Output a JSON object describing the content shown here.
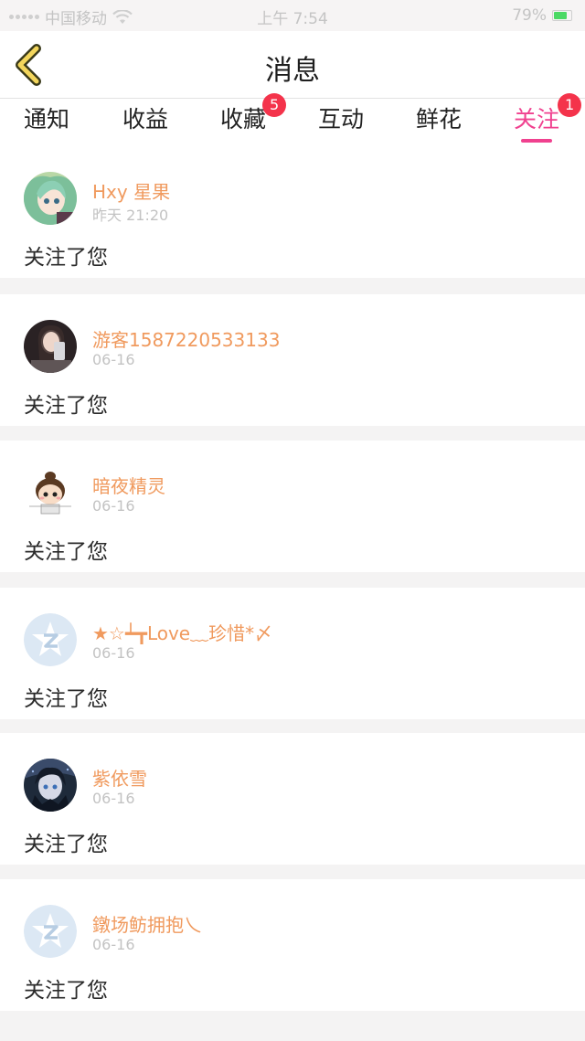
{
  "status_bar": {
    "carrier": "中国移动",
    "time": "上午 7:54",
    "battery": "79%"
  },
  "header": {
    "title": "消息"
  },
  "tabs": [
    {
      "label": "通知",
      "badge": ""
    },
    {
      "label": "收益",
      "badge": ""
    },
    {
      "label": "收藏",
      "badge": "5"
    },
    {
      "label": "互动",
      "badge": ""
    },
    {
      "label": "鲜花",
      "badge": ""
    },
    {
      "label": "关注",
      "badge": "1"
    }
  ],
  "active_tab": "关注",
  "accent_color": "#f0418f",
  "badge_color": "#f4334b",
  "name_color": "#f09a5e",
  "notifications": [
    {
      "name": "Hxy 星果",
      "time": "昨天 21:20",
      "message": "关注了您",
      "avatar": "anime-girl-avatar"
    },
    {
      "name": "游客1587220533133",
      "time": "06-16",
      "message": "关注了您",
      "avatar": "selfie-photo-avatar"
    },
    {
      "name": "暗夜精灵",
      "time": "06-16",
      "message": "关注了您",
      "avatar": "cartoon-boy-avatar"
    },
    {
      "name": "★☆┷┳Love﹏珍惜*〆",
      "time": "06-16",
      "message": "关注了您",
      "avatar": "default-z-avatar"
    },
    {
      "name": "紫依雪",
      "time": "06-16",
      "message": "关注了您",
      "avatar": "dark-anime-avatar"
    },
    {
      "name": "鐓场鲂拥抱乀",
      "time": "06-16",
      "message": "关注了您",
      "avatar": "default-z-avatar"
    }
  ]
}
